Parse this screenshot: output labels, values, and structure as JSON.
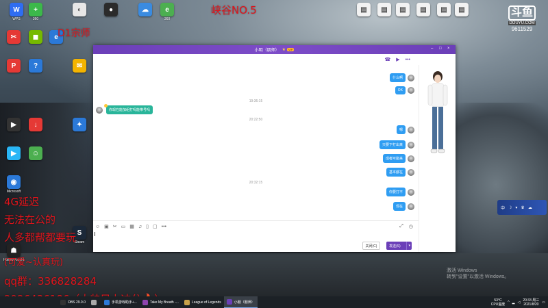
{
  "stream_overlay": {
    "title": "峡谷NO.5",
    "subtitle": "D1宗师",
    "notes": [
      "4G延迟",
      "无法在公的",
      "人多都帮都要玩",
      "(可爱~认真玩)",
      "qq群：336828284",
      "2926436186（大帅只上冲分🔥）"
    ]
  },
  "douyu": {
    "logo": "斗鱼",
    "tag": "DOUYU.COM",
    "room": "9611529"
  },
  "desktop_icons": [
    {
      "label": "WPS",
      "color": "#2f6df2",
      "glyph": "W"
    },
    {
      "label": "360",
      "color": "#3cb84a",
      "glyph": "+"
    },
    {
      "label": "",
      "color": "#e7e7e7",
      "glyph": "◐"
    },
    {
      "label": "",
      "color": "#2b2b2b",
      "glyph": "●"
    },
    {
      "label": "",
      "color": "#3a8be0",
      "glyph": "☁"
    },
    {
      "label": "360",
      "color": "#4caf50",
      "glyph": "e"
    },
    {
      "label": "",
      "color": "#f2f2f2",
      "glyph": "▤"
    },
    {
      "label": "",
      "color": "#f2f2f2",
      "glyph": "▤"
    },
    {
      "label": "",
      "color": "#f2f2f2",
      "glyph": "▤"
    },
    {
      "label": "",
      "color": "#f2f2f2",
      "glyph": "▤"
    },
    {
      "label": "",
      "color": "#f2f2f2",
      "glyph": "▤"
    },
    {
      "label": "",
      "color": "#f2f2f2",
      "glyph": "▤"
    }
  ],
  "left_icons": [
    {
      "label": "",
      "color": "#e53935",
      "glyph": "✂"
    },
    {
      "label": "",
      "color": "#76b900",
      "glyph": "◼"
    },
    {
      "label": "",
      "color": "#2b79d8",
      "glyph": "e"
    },
    {
      "label": "",
      "color": "#e53935",
      "glyph": "P"
    },
    {
      "label": "",
      "color": "#2b79d8",
      "glyph": "?"
    },
    {
      "label": "",
      "color": "#f4b400",
      "glyph": "✉"
    },
    {
      "label": "",
      "color": "#333",
      "glyph": "▶"
    },
    {
      "label": "",
      "color": "#e53935",
      "glyph": "↓"
    },
    {
      "label": "",
      "color": "#2b79d8",
      "glyph": "✦"
    },
    {
      "label": "",
      "color": "#29b6f6",
      "glyph": "▶"
    },
    {
      "label": "",
      "color": "#4caf50",
      "glyph": "☺"
    },
    {
      "label": "Microsoft",
      "color": "#2b79d8",
      "glyph": "◉"
    },
    {
      "label": "Steam",
      "color": "#1b2838",
      "glyph": "S"
    },
    {
      "label": "Hollow Knight",
      "color": "#222",
      "glyph": "☗"
    }
  ],
  "chat": {
    "title": "小明（朋师）",
    "title_badge": "VIP",
    "toolbar_icons": [
      "phone-icon",
      "video-icon",
      "more-icon"
    ],
    "timestamps": [
      "19:36:15",
      "20:22:50",
      "20:32:15"
    ],
    "left_message": "你现在能加组打吗能带号吗",
    "right_messages": [
      "什么啊",
      "OK",
      "嗯",
      "只要下打出来",
      "成者可能来",
      "基本都在",
      "你要打不",
      "现在"
    ],
    "input_placeholder": "",
    "close_label": "关闭(C)",
    "send_label": "发送(S)"
  },
  "tray_popup": {
    "items": [
      "中",
      "☽",
      "▾",
      "♛",
      "☁"
    ]
  },
  "windows_activation": {
    "line1": "激活 Windows",
    "line2": "转到\"设置\"以激活 Windows。"
  },
  "taskbar": {
    "items": [
      {
        "label": "OBS 29.0.0",
        "color": "#333",
        "active": false
      },
      {
        "label": "",
        "color": "#aaa",
        "active": false
      },
      {
        "label": "手机游戏助手+...",
        "color": "#2b79d8",
        "active": false
      },
      {
        "label": "Take My Breath -...",
        "color": "#8e44ad",
        "active": false
      },
      {
        "label": "League of Legends",
        "color": "#c9a24a",
        "active": false
      },
      {
        "label": "小朋（朋师）",
        "color": "#6b3fb8",
        "active": true
      }
    ],
    "temp": "53°C",
    "cpu": "CPU温度",
    "time": "20:33 周三",
    "date": "2021/8/20"
  }
}
